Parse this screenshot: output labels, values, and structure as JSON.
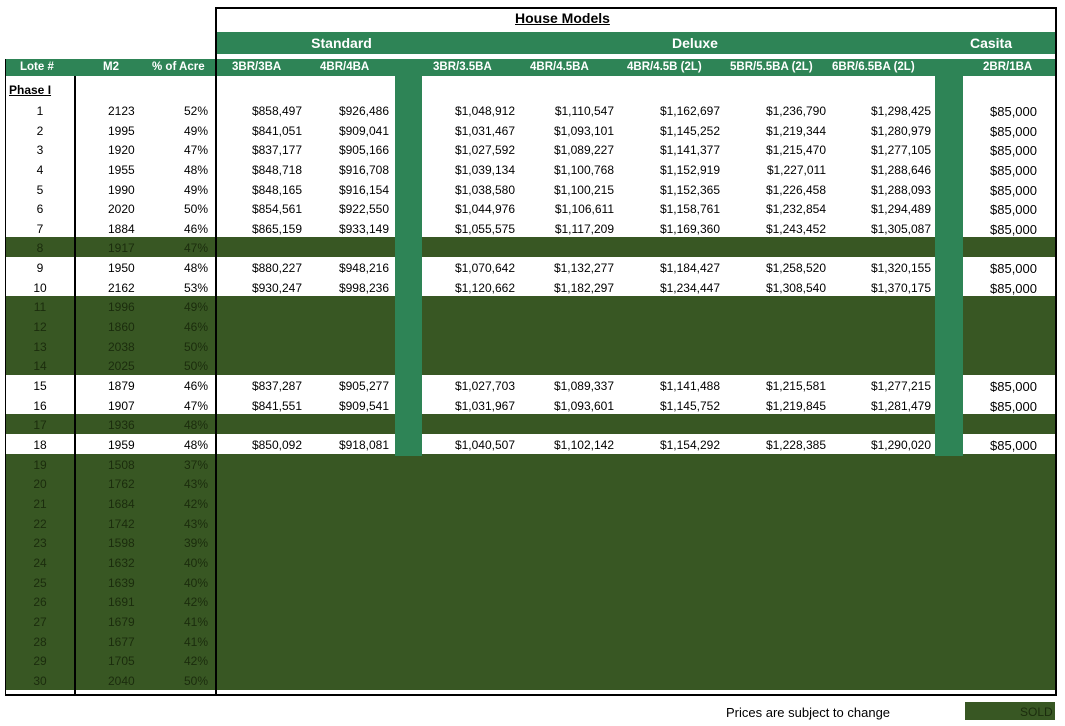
{
  "title": "House Models",
  "groups": [
    {
      "key": "standard",
      "label": "Standard"
    },
    {
      "key": "deluxe",
      "label": "Deluxe"
    },
    {
      "key": "casita",
      "label": "Casita"
    }
  ],
  "columns": {
    "lot": "Lote #",
    "m2": "M2",
    "acre": "% of Acre",
    "models": [
      "3BR/3BA",
      "4BR/4BA",
      "3BR/3.5BA",
      "4BR/4.5BA",
      "4BR/4.5B (2L)",
      "5BR/5.5BA (2L)",
      "6BR/6.5BA (2L)",
      "2BR/1BA"
    ]
  },
  "phase_label": "Phase I",
  "rows": [
    {
      "lot": "1",
      "m2": "2123",
      "acre": "52%",
      "sold": false,
      "prices": [
        "$858,497",
        "$926,486",
        "$1,048,912",
        "$1,110,547",
        "$1,162,697",
        "$1,236,790",
        "$1,298,425",
        "$85,000"
      ]
    },
    {
      "lot": "2",
      "m2": "1995",
      "acre": "49%",
      "sold": false,
      "prices": [
        "$841,051",
        "$909,041",
        "$1,031,467",
        "$1,093,101",
        "$1,145,252",
        "$1,219,344",
        "$1,280,979",
        "$85,000"
      ]
    },
    {
      "lot": "3",
      "m2": "1920",
      "acre": "47%",
      "sold": false,
      "prices": [
        "$837,177",
        "$905,166",
        "$1,027,592",
        "$1,089,227",
        "$1,141,377",
        "$1,215,470",
        "$1,277,105",
        "$85,000"
      ]
    },
    {
      "lot": "4",
      "m2": "1955",
      "acre": "48%",
      "sold": false,
      "prices": [
        "$848,718",
        "$916,708",
        "$1,039,134",
        "$1,100,768",
        "$1,152,919",
        "$1,227,011",
        "$1,288,646",
        "$85,000"
      ]
    },
    {
      "lot": "5",
      "m2": "1990",
      "acre": "49%",
      "sold": false,
      "prices": [
        "$848,165",
        "$916,154",
        "$1,038,580",
        "$1,100,215",
        "$1,152,365",
        "$1,226,458",
        "$1,288,093",
        "$85,000"
      ]
    },
    {
      "lot": "6",
      "m2": "2020",
      "acre": "50%",
      "sold": false,
      "prices": [
        "$854,561",
        "$922,550",
        "$1,044,976",
        "$1,106,611",
        "$1,158,761",
        "$1,232,854",
        "$1,294,489",
        "$85,000"
      ]
    },
    {
      "lot": "7",
      "m2": "1884",
      "acre": "46%",
      "sold": false,
      "prices": [
        "$865,159",
        "$933,149",
        "$1,055,575",
        "$1,117,209",
        "$1,169,360",
        "$1,243,452",
        "$1,305,087",
        "$85,000"
      ]
    },
    {
      "lot": "8",
      "m2": "1917",
      "acre": "47%",
      "sold": true
    },
    {
      "lot": "9",
      "m2": "1950",
      "acre": "48%",
      "sold": false,
      "prices": [
        "$880,227",
        "$948,216",
        "$1,070,642",
        "$1,132,277",
        "$1,184,427",
        "$1,258,520",
        "$1,320,155",
        "$85,000"
      ]
    },
    {
      "lot": "10",
      "m2": "2162",
      "acre": "53%",
      "sold": false,
      "prices": [
        "$930,247",
        "$998,236",
        "$1,120,662",
        "$1,182,297",
        "$1,234,447",
        "$1,308,540",
        "$1,370,175",
        "$85,000"
      ]
    },
    {
      "lot": "11",
      "m2": "1996",
      "acre": "49%",
      "sold": true
    },
    {
      "lot": "12",
      "m2": "1860",
      "acre": "46%",
      "sold": true
    },
    {
      "lot": "13",
      "m2": "2038",
      "acre": "50%",
      "sold": true
    },
    {
      "lot": "14",
      "m2": "2025",
      "acre": "50%",
      "sold": true
    },
    {
      "lot": "15",
      "m2": "1879",
      "acre": "46%",
      "sold": false,
      "prices": [
        "$837,287",
        "$905,277",
        "$1,027,703",
        "$1,089,337",
        "$1,141,488",
        "$1,215,581",
        "$1,277,215",
        "$85,000"
      ]
    },
    {
      "lot": "16",
      "m2": "1907",
      "acre": "47%",
      "sold": false,
      "prices": [
        "$841,551",
        "$909,541",
        "$1,031,967",
        "$1,093,601",
        "$1,145,752",
        "$1,219,845",
        "$1,281,479",
        "$85,000"
      ]
    },
    {
      "lot": "17",
      "m2": "1936",
      "acre": "48%",
      "sold": true
    },
    {
      "lot": "18",
      "m2": "1959",
      "acre": "48%",
      "sold": false,
      "prices": [
        "$850,092",
        "$918,081",
        "$1,040,507",
        "$1,102,142",
        "$1,154,292",
        "$1,228,385",
        "$1,290,020",
        "$85,000"
      ]
    },
    {
      "lot": "19",
      "m2": "1508",
      "acre": "37%",
      "sold": true
    },
    {
      "lot": "20",
      "m2": "1762",
      "acre": "43%",
      "sold": true
    },
    {
      "lot": "21",
      "m2": "1684",
      "acre": "42%",
      "sold": true
    },
    {
      "lot": "22",
      "m2": "1742",
      "acre": "43%",
      "sold": true
    },
    {
      "lot": "23",
      "m2": "1598",
      "acre": "39%",
      "sold": true
    },
    {
      "lot": "24",
      "m2": "1632",
      "acre": "40%",
      "sold": true
    },
    {
      "lot": "25",
      "m2": "1639",
      "acre": "40%",
      "sold": true
    },
    {
      "lot": "26",
      "m2": "1691",
      "acre": "42%",
      "sold": true
    },
    {
      "lot": "27",
      "m2": "1679",
      "acre": "41%",
      "sold": true
    },
    {
      "lot": "28",
      "m2": "1677",
      "acre": "41%",
      "sold": true
    },
    {
      "lot": "29",
      "m2": "1705",
      "acre": "42%",
      "sold": true
    },
    {
      "lot": "30",
      "m2": "2040",
      "acre": "50%",
      "sold": true
    }
  ],
  "footer": {
    "note": "Prices are subject to change",
    "legend_sold": "SOLD"
  },
  "colors": {
    "header_green": "#2e8456",
    "sold_green": "#385723",
    "sold_text": "#1b2c0d"
  }
}
